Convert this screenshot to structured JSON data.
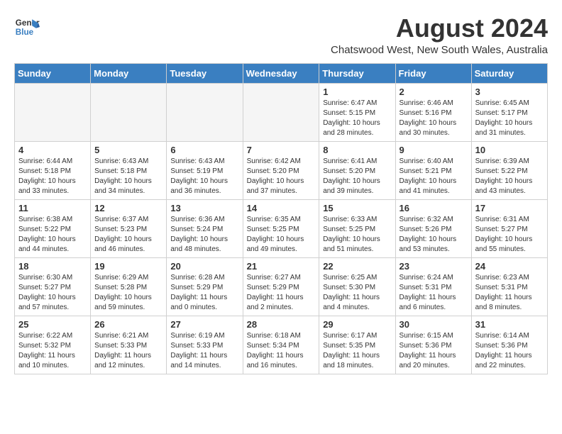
{
  "header": {
    "logo_line1": "General",
    "logo_line2": "Blue",
    "month_year": "August 2024",
    "location": "Chatswood West, New South Wales, Australia"
  },
  "days_of_week": [
    "Sunday",
    "Monday",
    "Tuesday",
    "Wednesday",
    "Thursday",
    "Friday",
    "Saturday"
  ],
  "weeks": [
    [
      {
        "day": "",
        "info": ""
      },
      {
        "day": "",
        "info": ""
      },
      {
        "day": "",
        "info": ""
      },
      {
        "day": "",
        "info": ""
      },
      {
        "day": "1",
        "info": "Sunrise: 6:47 AM\nSunset: 5:15 PM\nDaylight: 10 hours\nand 28 minutes."
      },
      {
        "day": "2",
        "info": "Sunrise: 6:46 AM\nSunset: 5:16 PM\nDaylight: 10 hours\nand 30 minutes."
      },
      {
        "day": "3",
        "info": "Sunrise: 6:45 AM\nSunset: 5:17 PM\nDaylight: 10 hours\nand 31 minutes."
      }
    ],
    [
      {
        "day": "4",
        "info": "Sunrise: 6:44 AM\nSunset: 5:18 PM\nDaylight: 10 hours\nand 33 minutes."
      },
      {
        "day": "5",
        "info": "Sunrise: 6:43 AM\nSunset: 5:18 PM\nDaylight: 10 hours\nand 34 minutes."
      },
      {
        "day": "6",
        "info": "Sunrise: 6:43 AM\nSunset: 5:19 PM\nDaylight: 10 hours\nand 36 minutes."
      },
      {
        "day": "7",
        "info": "Sunrise: 6:42 AM\nSunset: 5:20 PM\nDaylight: 10 hours\nand 37 minutes."
      },
      {
        "day": "8",
        "info": "Sunrise: 6:41 AM\nSunset: 5:20 PM\nDaylight: 10 hours\nand 39 minutes."
      },
      {
        "day": "9",
        "info": "Sunrise: 6:40 AM\nSunset: 5:21 PM\nDaylight: 10 hours\nand 41 minutes."
      },
      {
        "day": "10",
        "info": "Sunrise: 6:39 AM\nSunset: 5:22 PM\nDaylight: 10 hours\nand 43 minutes."
      }
    ],
    [
      {
        "day": "11",
        "info": "Sunrise: 6:38 AM\nSunset: 5:22 PM\nDaylight: 10 hours\nand 44 minutes."
      },
      {
        "day": "12",
        "info": "Sunrise: 6:37 AM\nSunset: 5:23 PM\nDaylight: 10 hours\nand 46 minutes."
      },
      {
        "day": "13",
        "info": "Sunrise: 6:36 AM\nSunset: 5:24 PM\nDaylight: 10 hours\nand 48 minutes."
      },
      {
        "day": "14",
        "info": "Sunrise: 6:35 AM\nSunset: 5:25 PM\nDaylight: 10 hours\nand 49 minutes."
      },
      {
        "day": "15",
        "info": "Sunrise: 6:33 AM\nSunset: 5:25 PM\nDaylight: 10 hours\nand 51 minutes."
      },
      {
        "day": "16",
        "info": "Sunrise: 6:32 AM\nSunset: 5:26 PM\nDaylight: 10 hours\nand 53 minutes."
      },
      {
        "day": "17",
        "info": "Sunrise: 6:31 AM\nSunset: 5:27 PM\nDaylight: 10 hours\nand 55 minutes."
      }
    ],
    [
      {
        "day": "18",
        "info": "Sunrise: 6:30 AM\nSunset: 5:27 PM\nDaylight: 10 hours\nand 57 minutes."
      },
      {
        "day": "19",
        "info": "Sunrise: 6:29 AM\nSunset: 5:28 PM\nDaylight: 10 hours\nand 59 minutes."
      },
      {
        "day": "20",
        "info": "Sunrise: 6:28 AM\nSunset: 5:29 PM\nDaylight: 11 hours\nand 0 minutes."
      },
      {
        "day": "21",
        "info": "Sunrise: 6:27 AM\nSunset: 5:29 PM\nDaylight: 11 hours\nand 2 minutes."
      },
      {
        "day": "22",
        "info": "Sunrise: 6:25 AM\nSunset: 5:30 PM\nDaylight: 11 hours\nand 4 minutes."
      },
      {
        "day": "23",
        "info": "Sunrise: 6:24 AM\nSunset: 5:31 PM\nDaylight: 11 hours\nand 6 minutes."
      },
      {
        "day": "24",
        "info": "Sunrise: 6:23 AM\nSunset: 5:31 PM\nDaylight: 11 hours\nand 8 minutes."
      }
    ],
    [
      {
        "day": "25",
        "info": "Sunrise: 6:22 AM\nSunset: 5:32 PM\nDaylight: 11 hours\nand 10 minutes."
      },
      {
        "day": "26",
        "info": "Sunrise: 6:21 AM\nSunset: 5:33 PM\nDaylight: 11 hours\nand 12 minutes."
      },
      {
        "day": "27",
        "info": "Sunrise: 6:19 AM\nSunset: 5:33 PM\nDaylight: 11 hours\nand 14 minutes."
      },
      {
        "day": "28",
        "info": "Sunrise: 6:18 AM\nSunset: 5:34 PM\nDaylight: 11 hours\nand 16 minutes."
      },
      {
        "day": "29",
        "info": "Sunrise: 6:17 AM\nSunset: 5:35 PM\nDaylight: 11 hours\nand 18 minutes."
      },
      {
        "day": "30",
        "info": "Sunrise: 6:15 AM\nSunset: 5:36 PM\nDaylight: 11 hours\nand 20 minutes."
      },
      {
        "day": "31",
        "info": "Sunrise: 6:14 AM\nSunset: 5:36 PM\nDaylight: 11 hours\nand 22 minutes."
      }
    ]
  ]
}
